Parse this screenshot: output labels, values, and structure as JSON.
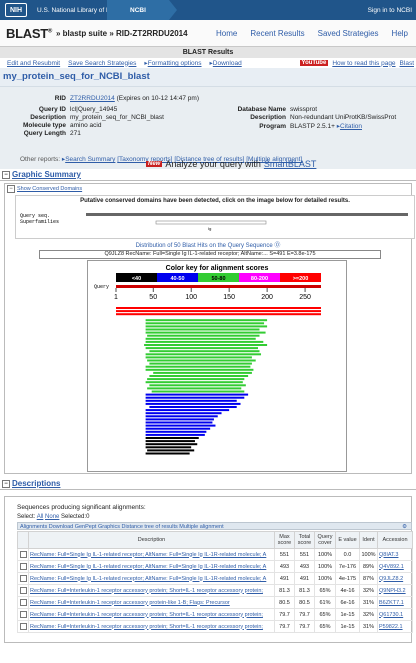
{
  "topbar": {
    "nih": "NIH",
    "nlm": "U.S. National Library of Medicine",
    "ncbi": "NCBI",
    "signin": "Sign in to NCBI"
  },
  "header": {
    "logo": "BLAST",
    "reg": "®",
    "crumb": "» blastp suite » RID-ZT2RRDU2014",
    "nav": [
      "Home",
      "Recent Results",
      "Saved Strategies",
      "Help"
    ]
  },
  "results_title": "BLAST Results",
  "toolbar": {
    "edit": "Edit and Resubmit",
    "save": "Save Search Strategies",
    "format": "Formatting options",
    "download": "Download",
    "howto": "How to read this page",
    "blast": "Blast",
    "yt": "YouTube"
  },
  "query_title": "my_protein_seq_for_NCBI_blast",
  "info": {
    "rid_k": "RID",
    "rid_v": "ZT2RRDU2014",
    "rid_exp": "(Expires on 10-12 14:47 pm)",
    "qid_k": "Query ID",
    "qid_v": "lcl|Query_14945",
    "desc_k": "Description",
    "desc_v": "my_protein_seq_for_NCBI_blast",
    "mol_k": "Molecule type",
    "mol_v": "amino acid",
    "qlen_k": "Query Length",
    "qlen_v": "271",
    "db_k": "Database Name",
    "db_v": "swissprot",
    "ddesc_k": "Description",
    "ddesc_v": "Non-redundant UniProtKB/SwissProt",
    "prog_k": "Program",
    "prog_v": "BLASTP 2.5.1+",
    "citation": "Citation",
    "other_label": "Other reports:",
    "other_links": [
      "Search Summary",
      "[Taxonomy reports]",
      "[Distance tree of results]",
      "[Multiple alignment]"
    ],
    "new_badge": "New",
    "analyze": "Analyze your query with",
    "smartblast": "SmartBLAST"
  },
  "graphic": {
    "heading": "Graphic Summary",
    "show_cd": "Show Conserved Domains",
    "domain_title": "Putative conserved domains have been detected, click on the image below for detailed results.",
    "query_seq": "Query seq.",
    "superfamilies": "Superfamilies",
    "domain_label": "Ig",
    "distribution": "Distribution of 50 Blast Hits on the Query Sequence",
    "hit_info": "Q9JLZ8 RecName: Full=Single Ig IL-1-related receptor; AltName:... S=491 E=3.8e-175",
    "color_key_title": "Color key for alignment scores",
    "color_key": [
      "<40",
      "40-50",
      "50-80",
      "80-200",
      ">=200"
    ],
    "colors": [
      "#000000",
      "#0000ee",
      "#33cc33",
      "#ff00ff",
      "#ff0000"
    ],
    "axis_label": "Query",
    "ticks": [
      "1",
      "50",
      "100",
      "150",
      "200",
      "250"
    ]
  },
  "descriptions": {
    "heading": "Descriptions",
    "seq_producing": "Sequences producing significant alignments:",
    "select_label": "Select:",
    "select_all": "All",
    "select_none": "None",
    "selected": "Selected:0",
    "tbl_toolbar": "Alignments  Download  GenPept  Graphics  Distance tree of results  Multiple alignment",
    "columns": [
      "",
      "Description",
      "Max score",
      "Total score",
      "Query cover",
      "E value",
      "Ident",
      "Accession"
    ],
    "rows": [
      [
        "RecName: Full=Single Ig IL-1-related receptor; AltName: Full=Single Ig IL-1R-related molecule; A",
        "551",
        "551",
        "100%",
        "0.0",
        "100%",
        "Q8IAT.3"
      ],
      [
        "RecName: Full=Single Ig IL-1-related receptor; AltName: Full=Single Ig IL-1R-related molecule; A",
        "493",
        "493",
        "100%",
        "7e-176",
        "89%",
        "Q4V892.1"
      ],
      [
        "RecName: Full=Single Ig IL-1-related receptor; AltName: Full=Single Ig IL-1R-related molecule; A",
        "491",
        "491",
        "100%",
        "4e-175",
        "87%",
        "Q9JLZ8.2"
      ],
      [
        "RecName: Full=Interleukin-1 receptor accessory protein; Short=IL-1 receptor accessory protein; ",
        "81.3",
        "81.3",
        "65%",
        "4e-16",
        "32%",
        "Q9NPH3.2"
      ],
      [
        "RecName: Full=Interleukin-1 receptor accessory protein-like 1-B; Flags: Precursor",
        "80.5",
        "80.5",
        "61%",
        "6e-16",
        "31%",
        "B6ZKT7.1"
      ],
      [
        "RecName: Full=Interleukin-1 receptor accessory protein; Short=IL-1 receptor accessory protein; ",
        "79.7",
        "79.7",
        "65%",
        "1e-15",
        "32%",
        "Q61730.1"
      ],
      [
        "RecName: Full=Interleukin-1 receptor accessory protein; Short=IL-1 receptor accessory protein; ",
        "79.7",
        "79.7",
        "65%",
        "1e-15",
        "31%",
        "P59822.1"
      ]
    ]
  }
}
